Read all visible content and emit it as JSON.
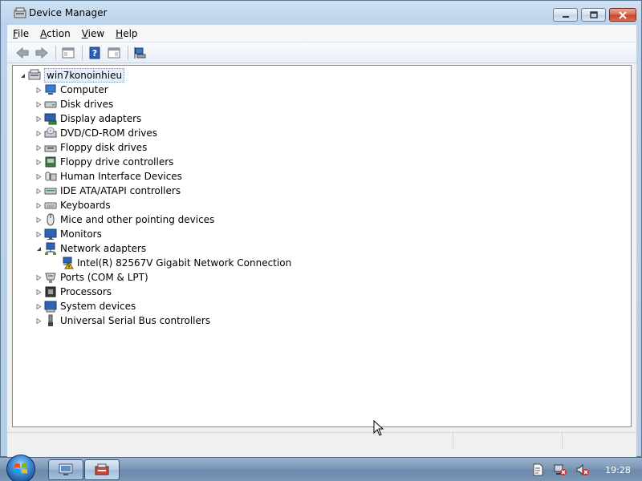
{
  "window": {
    "title": "Device Manager"
  },
  "menu": {
    "file": {
      "accel": "F",
      "rest": "ile"
    },
    "action": {
      "accel": "A",
      "rest": "ction"
    },
    "view": {
      "accel": "V",
      "rest": "iew"
    },
    "help": {
      "accel": "H",
      "rest": "elp"
    }
  },
  "toolbar": {
    "buttons": [
      "back-arrow-icon",
      "forward-arrow-icon",
      "show-hide-console-tree-icon",
      "help-icon",
      "properties-icon",
      "scan-hardware-icon"
    ]
  },
  "tree": {
    "root": "win7konoinhieu",
    "categories": [
      {
        "label": "Computer",
        "icon": "computer-icon",
        "expanded": false
      },
      {
        "label": "Disk drives",
        "icon": "disk-drive-icon",
        "expanded": false
      },
      {
        "label": "Display adapters",
        "icon": "display-adapter-icon",
        "expanded": false
      },
      {
        "label": "DVD/CD-ROM drives",
        "icon": "dvd-drive-icon",
        "expanded": false
      },
      {
        "label": "Floppy disk drives",
        "icon": "floppy-disk-icon",
        "expanded": false
      },
      {
        "label": "Floppy drive controllers",
        "icon": "floppy-controller-icon",
        "expanded": false
      },
      {
        "label": "Human Interface Devices",
        "icon": "hid-icon",
        "expanded": false
      },
      {
        "label": "IDE ATA/ATAPI controllers",
        "icon": "ide-controller-icon",
        "expanded": false
      },
      {
        "label": "Keyboards",
        "icon": "keyboard-icon",
        "expanded": false
      },
      {
        "label": "Mice and other pointing devices",
        "icon": "mouse-icon",
        "expanded": false
      },
      {
        "label": "Monitors",
        "icon": "monitor-icon",
        "expanded": false
      },
      {
        "label": "Network adapters",
        "icon": "network-adapter-icon",
        "expanded": true
      },
      {
        "label": "Ports (COM & LPT)",
        "icon": "port-icon",
        "expanded": false
      },
      {
        "label": "Processors",
        "icon": "processor-icon",
        "expanded": false
      },
      {
        "label": "System devices",
        "icon": "system-device-icon",
        "expanded": false
      },
      {
        "label": "Universal Serial Bus controllers",
        "icon": "usb-icon",
        "expanded": false
      }
    ],
    "network_child": "Intel(R) 82567V Gigabit Network Connection"
  },
  "taskbar": {
    "clock": "19:28"
  },
  "colors": {
    "accent": "#3f8fd8",
    "warning": "#f2c200"
  }
}
